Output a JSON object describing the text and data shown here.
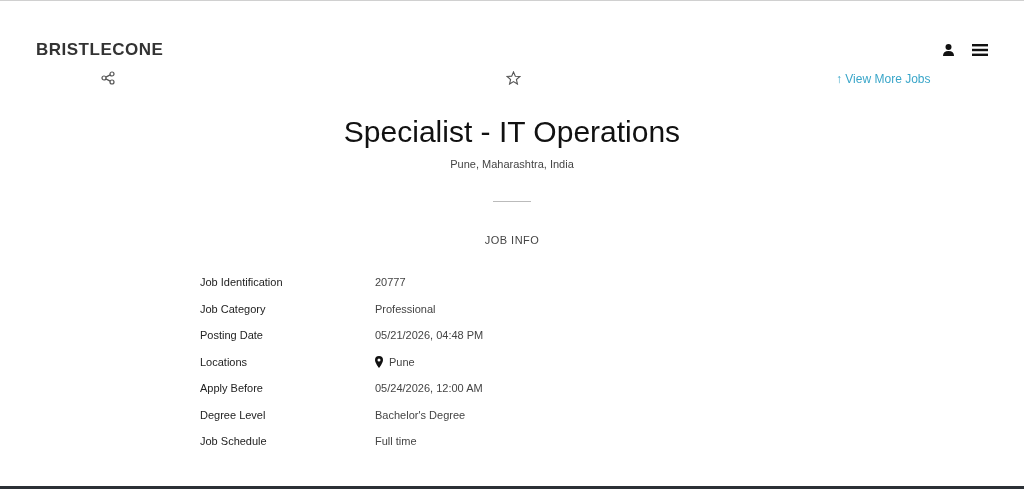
{
  "header": {
    "logo": "BRISTLECONE"
  },
  "actions": {
    "view_more": "↑ View More Jobs"
  },
  "job": {
    "title": "Specialist - IT Operations",
    "location": "Pune, Maharashtra, India"
  },
  "info": {
    "heading": "JOB INFO",
    "rows": [
      {
        "label": "Job Identification",
        "value": "20777",
        "kind": "text"
      },
      {
        "label": "Job Category",
        "value": "Professional",
        "kind": "text"
      },
      {
        "label": "Posting Date",
        "value": "05/21/2026, 04:48 PM",
        "kind": "text"
      },
      {
        "label": "Locations",
        "value": "Pune",
        "kind": "location"
      },
      {
        "label": "Apply Before",
        "value": "05/24/2026, 12:00 AM",
        "kind": "text"
      },
      {
        "label": "Degree Level",
        "value": "Bachelor's Degree",
        "kind": "text"
      },
      {
        "label": "Job Schedule",
        "value": "Full time",
        "kind": "text"
      }
    ]
  }
}
